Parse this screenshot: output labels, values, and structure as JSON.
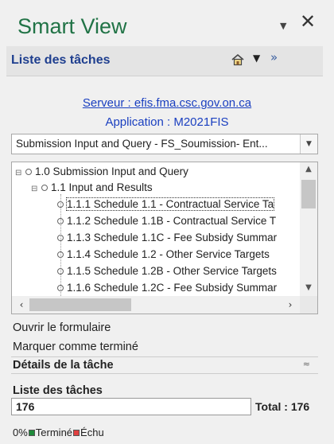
{
  "pane": {
    "title": "Smart View",
    "dropdown_icon": "chevron-down-icon",
    "close_icon": "close-icon"
  },
  "header": {
    "title": "Liste des tâches",
    "home_icon": "home-icon",
    "caret_icon": "caret-down-icon",
    "more_icon": "double-chevron-right-icon"
  },
  "connection": {
    "server": "Serveur : efis.fma.csc.gov.on.ca",
    "application": "Application : M2021FIS"
  },
  "task_select": {
    "value": "Submission Input and Query - FS_Soumission- Ent..."
  },
  "tree": {
    "items": [
      {
        "label": "1.0 Submission Input and Query",
        "level": 0
      },
      {
        "label": "1.1 Input and Results",
        "level": 1
      },
      {
        "label": "1.1.1 Schedule 1.1 - Contractual Service Ta",
        "level": 2,
        "selected": true
      },
      {
        "label": "1.1.2 Schedule 1.1B - Contractual Service T",
        "level": 2
      },
      {
        "label": "1.1.3 Schedule 1.1C - Fee Subsidy Summar",
        "level": 2
      },
      {
        "label": "1.1.4 Schedule 1.2 - Other Service Targets",
        "level": 2
      },
      {
        "label": "1.1.5 Schedule 1.2B - Other Service Targets",
        "level": 2
      },
      {
        "label": "1.1.6 Schedule 1.2C - Fee Subsidy Summar",
        "level": 2
      }
    ]
  },
  "actions": {
    "open_form": "Ouvrir le formulaire",
    "mark_complete": "Marquer comme terminé"
  },
  "details": {
    "label": "Détails de la tâche"
  },
  "task_list": {
    "label": "Liste des tâches",
    "count": "176",
    "total": "Total : 176",
    "progress": 0
  },
  "legend": {
    "percent": "0%",
    "done": "Terminé",
    "overdue": "Échu",
    "done_color": "#1e8a3a",
    "overdue_color": "#e04040"
  },
  "colors": {
    "accent": "#217346",
    "link": "#1a3fc0",
    "header_text": "#1f3f8f"
  }
}
